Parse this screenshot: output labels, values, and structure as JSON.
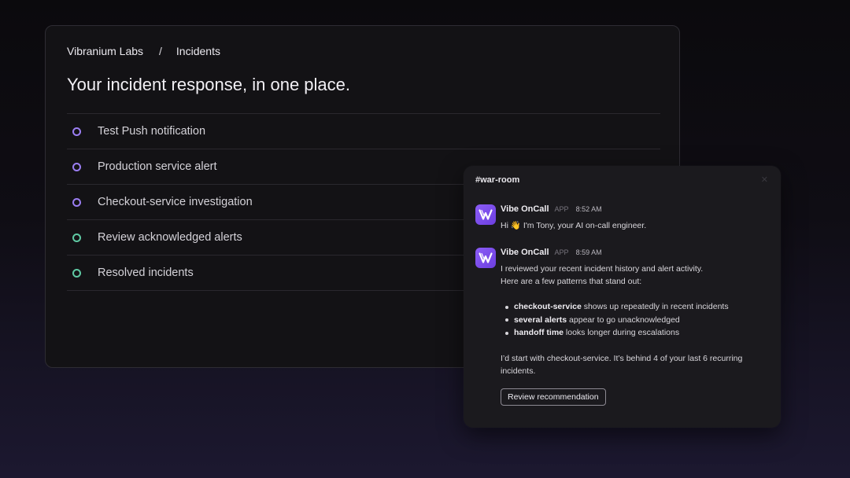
{
  "breadcrumb": {
    "org": "Vibranium Labs",
    "separator": "/",
    "section": "Incidents"
  },
  "page_title": "Your incident response, in one place.",
  "incidents": [
    {
      "label": "Test Push notification",
      "dot_color": "#9b7ef2"
    },
    {
      "label": "Production service alert",
      "dot_color": "#9b7ef2"
    },
    {
      "label": "Checkout-service investigation",
      "dot_color": "#9b7ef2"
    },
    {
      "label": "Review acknowledged alerts",
      "dot_color": "#5fc9a3"
    },
    {
      "label": "Resolved incidents",
      "dot_color": "#5fc9a3"
    }
  ],
  "chat": {
    "channel": "#war-room",
    "close_icon": "close-icon",
    "messages": [
      {
        "sender": "Vibe OnCall",
        "badge": "APP",
        "time": "8:52 AM",
        "text": "Hi 👋 I'm Tony, your AI on-call engineer."
      },
      {
        "sender": "Vibe OnCall",
        "badge": "APP",
        "time": "8:59 AM",
        "intro_1": "I reviewed your recent incident history and alert activity.",
        "intro_2": "Here are a few patterns that stand out:",
        "bullets": [
          {
            "bold": "checkout-service",
            "rest": " shows up repeatedly in recent incidents"
          },
          {
            "bold": "several alerts",
            "rest": " appear to go unacknowledged"
          },
          {
            "bold": "handoff time",
            "rest": " looks longer during escalations"
          }
        ],
        "closing_1": "I’d start with checkout-service. It’s behind 4 of your last 6 recurring",
        "closing_2": "incidents.",
        "button": "Review recommendation"
      }
    ]
  },
  "colors": {
    "accent_purple": "#8b5cf6",
    "dot_purple": "#9b7ef2",
    "dot_green": "#5fc9a3"
  }
}
